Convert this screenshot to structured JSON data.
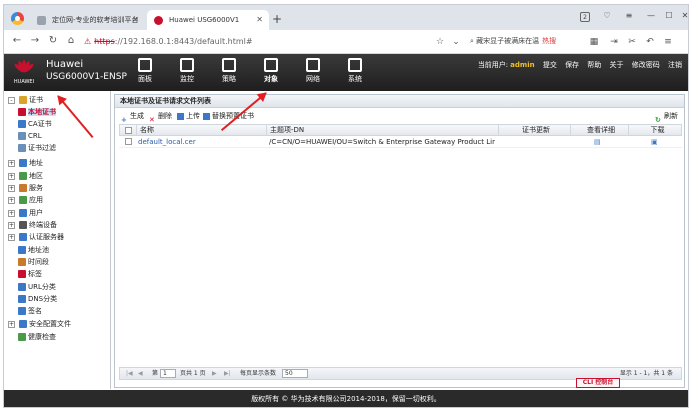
{
  "browser": {
    "tabs": [
      {
        "label": "定位网-专业的软考培训平台"
      },
      {
        "label": "Huawei USG6000V1"
      }
    ],
    "new_tab": "+",
    "badge": "2",
    "url_scheme": "https",
    "url_rest": "://192.168.0.1:8443/default.html#",
    "search_text": "藏宋显子被满床在温",
    "search_hot": "热搜"
  },
  "header": {
    "logo_text": "HUAWEI",
    "brand": "Huawei",
    "model": "USG6000V1-ENSP",
    "nav": [
      {
        "label": "面板"
      },
      {
        "label": "监控"
      },
      {
        "label": "策略"
      },
      {
        "label": "对象"
      },
      {
        "label": "网络"
      },
      {
        "label": "系统"
      }
    ],
    "user_prefix": "当前用户:",
    "user_name": "admin",
    "actions": [
      "提交",
      "保存",
      "帮助",
      "关于",
      "修改密码",
      "注销"
    ]
  },
  "sidebar": {
    "items": [
      {
        "label": "证书",
        "pm": "-",
        "color": "#d9a429"
      },
      {
        "label": "本地证书",
        "color": "#c8102e"
      },
      {
        "label": "CA证书",
        "color": "#3c78c8"
      },
      {
        "label": "CRL",
        "color": "#6a8fba"
      },
      {
        "label": "证书过滤",
        "color": "#6a8fba"
      },
      {
        "label": "地址",
        "pm": "+",
        "color": "#3c78c8"
      },
      {
        "label": "地区",
        "pm": "+",
        "color": "#4a9a4a"
      },
      {
        "label": "服务",
        "pm": "+",
        "color": "#c87a2a"
      },
      {
        "label": "应用",
        "pm": "+",
        "color": "#4a9a4a"
      },
      {
        "label": "用户",
        "pm": "+",
        "color": "#3c78c8"
      },
      {
        "label": "终端设备",
        "pm": "+",
        "color": "#555555"
      },
      {
        "label": "认证服务器",
        "pm": "+",
        "color": "#3c78c8"
      },
      {
        "label": "地址池",
        "color": "#3c78c8"
      },
      {
        "label": "时间段",
        "color": "#c87a2a"
      },
      {
        "label": "标签",
        "color": "#c8102e"
      },
      {
        "label": "URL分类",
        "color": "#3c78c8"
      },
      {
        "label": "DNS分类",
        "color": "#3c78c8"
      },
      {
        "label": "签名",
        "color": "#3c78c8"
      },
      {
        "label": "安全配置文件",
        "pm": "+",
        "color": "#3c78c8"
      },
      {
        "label": "健康检查",
        "color": "#4a9a4a"
      }
    ]
  },
  "main": {
    "title": "本地证书及证书请求文件列表",
    "toolbar": [
      "生成",
      "删除",
      "上传",
      "替换预置证书"
    ],
    "refresh": "刷新",
    "columns": [
      "名称",
      "主题项-DN",
      "证书更新",
      "查看详细",
      "下载"
    ],
    "rows": [
      {
        "name": "default_local.cer",
        "dn": "/C=CN/O=HUAWEI/OU=Switch & Enterprise Gateway Product Line/CN=..."
      }
    ],
    "pager": {
      "page_prefix": "第",
      "page_value": "1",
      "page_suffix": "页共 1 页",
      "per_page_label": "每页显示条数",
      "per_page_value": "50",
      "summary": "显示 1 - 1，共 1 条"
    },
    "cli_button": "CLI 控制台"
  },
  "footer": {
    "text": "版权所有 © 华为技术有限公司2014-2018，保留一切权利。"
  }
}
